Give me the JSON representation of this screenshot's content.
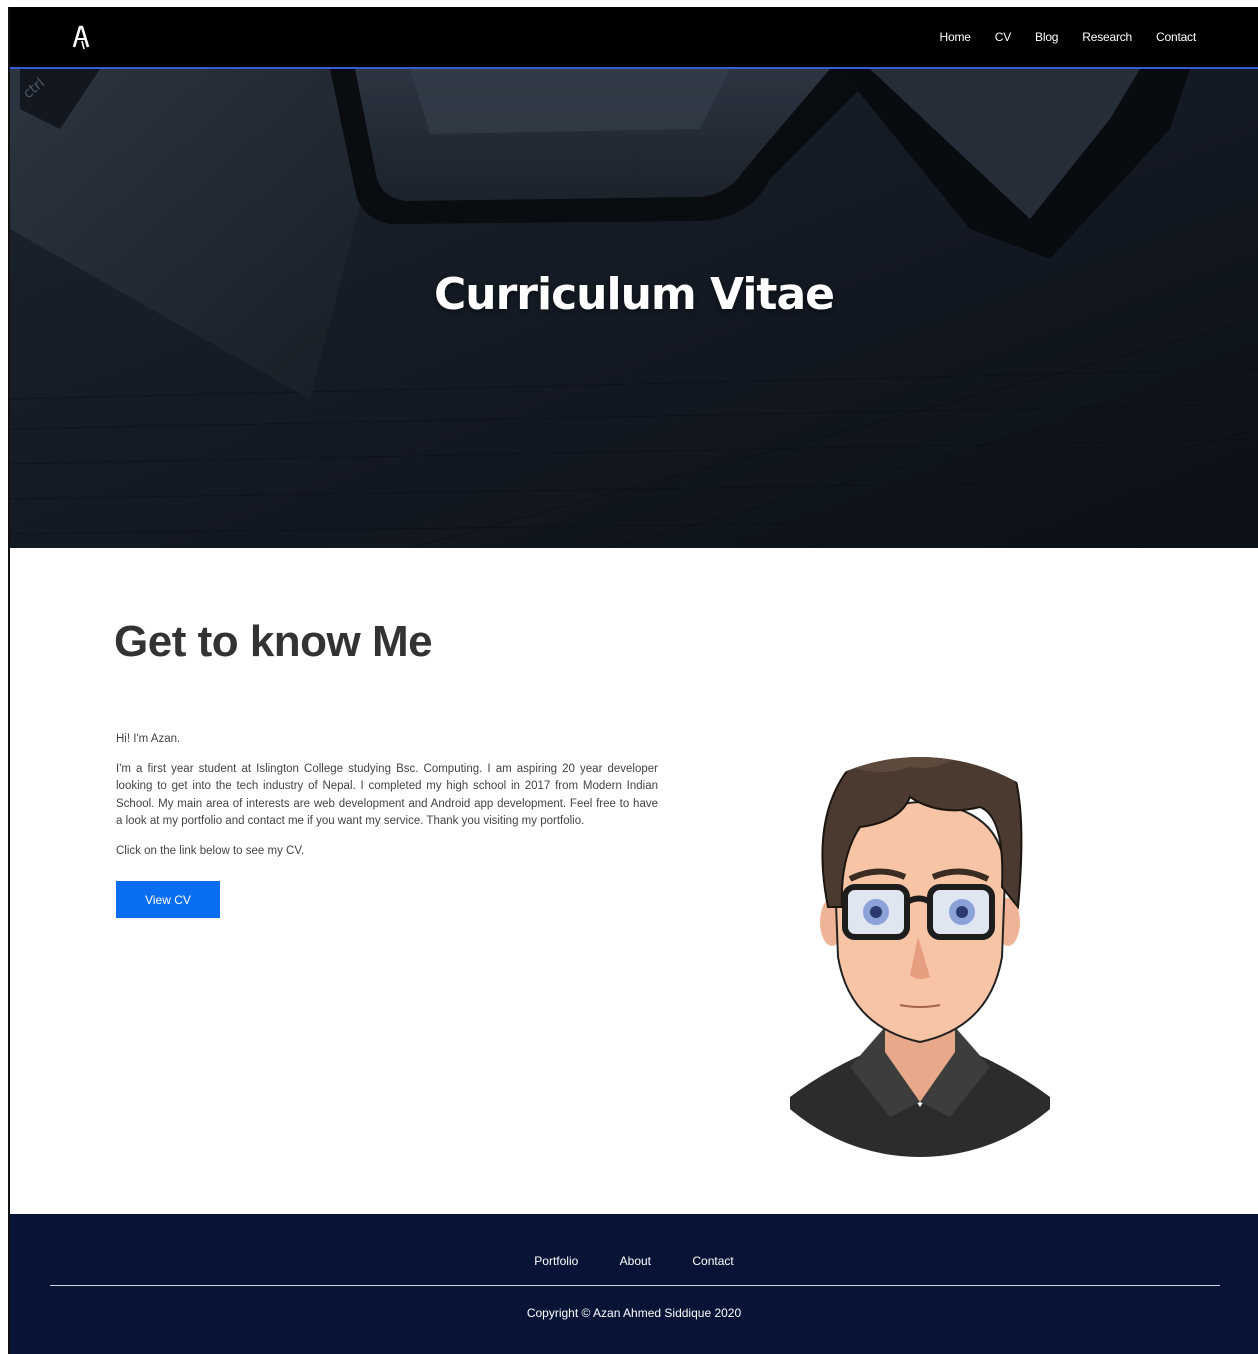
{
  "nav": {
    "logo": "A",
    "links": [
      "Home",
      "CV",
      "Blog",
      "Research",
      "Contact"
    ]
  },
  "hero": {
    "title": "Curriculum Vitae",
    "keyboard_key": "ctrl"
  },
  "about": {
    "heading": "Get to know Me",
    "greeting": "Hi! I'm Azan.",
    "bio": "I'm a first year student at Islington College studying Bsc. Computing. I am aspiring 20 year developer looking to get into the tech industry of Nepal. I completed my high school in 2017 from Modern Indian School. My main area of interests are web development and Android app development. Feel free to have a look at my portfolio and contact me if you want my service. Thank you visiting my portfolio.",
    "cta_text": "Click on the link below to see my CV.",
    "button_label": "View CV"
  },
  "footer": {
    "links": [
      "Portfolio",
      "About",
      "Contact"
    ],
    "copyright": "Copyright © Azan Ahmed Siddique 2020"
  },
  "colors": {
    "navbar": "#000000",
    "nav_accent": "#3a5bd8",
    "button": "#0a6ef2",
    "footer": "#071436",
    "heading": "#333333"
  }
}
